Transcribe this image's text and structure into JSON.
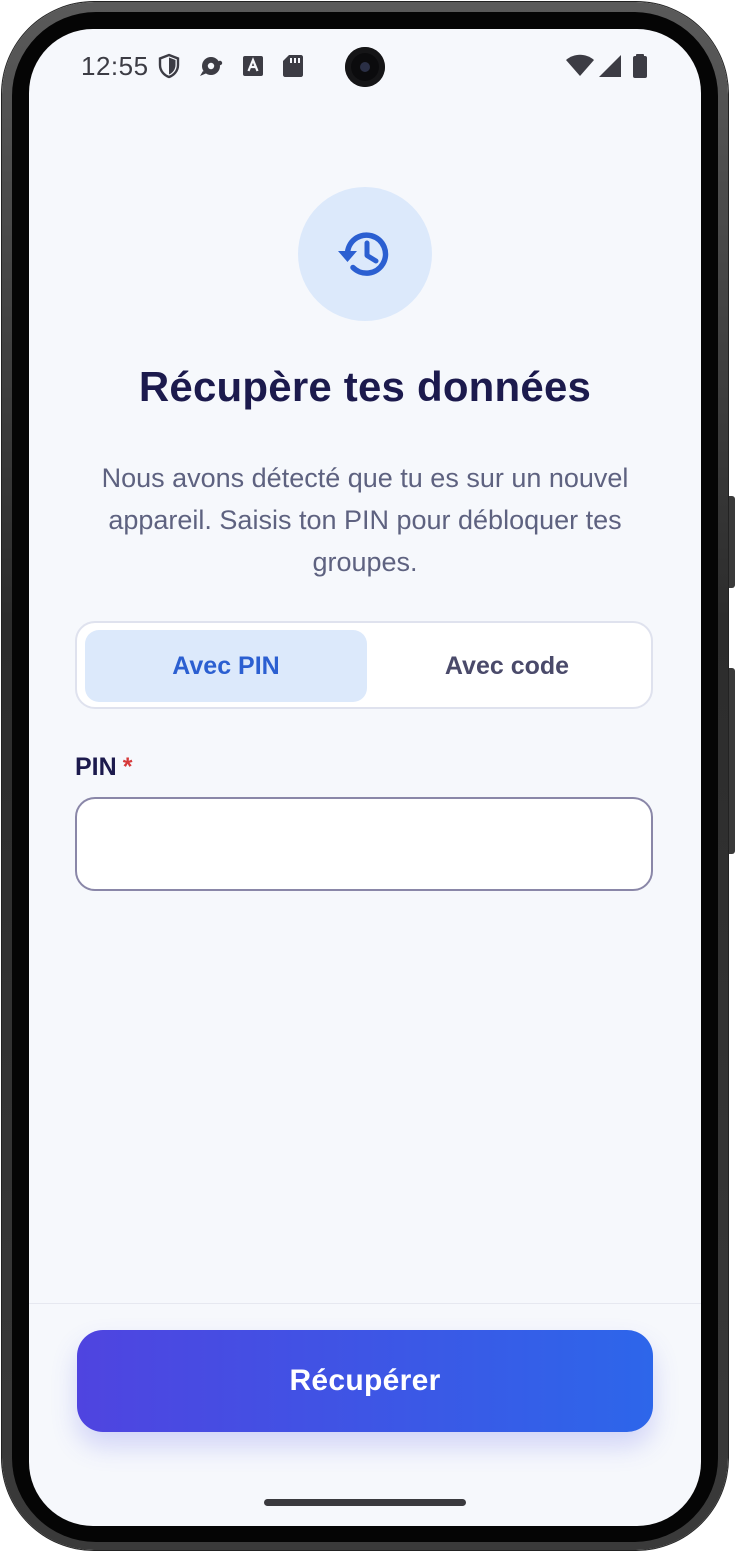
{
  "status_bar": {
    "time": "12:55",
    "left_icons": [
      "shield-icon",
      "chat-bubble-icon",
      "a-badge-icon",
      "sd-card-icon"
    ],
    "right_icons": [
      "wifi-icon",
      "signal-icon",
      "battery-icon"
    ]
  },
  "hero": {
    "icon": "history-restore-icon",
    "accent_color": "#2b5fd1",
    "circle_color": "#dce9fb"
  },
  "screen": {
    "title": "Récupère tes données",
    "subtitle": "Nous avons détecté que tu es sur un nouvel appareil. Saisis ton PIN pour débloquer tes groupes."
  },
  "tabs": [
    {
      "label": "Avec PIN",
      "selected": true
    },
    {
      "label": "Avec code",
      "selected": false
    }
  ],
  "pin_field": {
    "label": "PIN",
    "required_marker": "*",
    "value": "",
    "placeholder": ""
  },
  "primary_button": {
    "label": "Récupérer",
    "gradient_start": "#4f44e0",
    "gradient_end": "#2d66ea"
  }
}
